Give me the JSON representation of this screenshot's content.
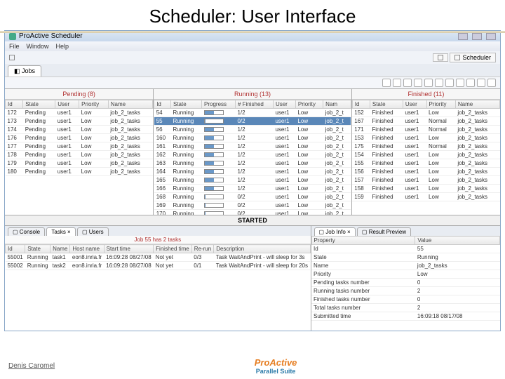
{
  "slide": {
    "title": "Scheduler: User Interface"
  },
  "window": {
    "title": "ProActive Scheduler"
  },
  "menu": {
    "items": [
      "File",
      "Window",
      "Help"
    ]
  },
  "perspective": {
    "label": "Scheduler"
  },
  "jobs_tab": {
    "label": "Jobs"
  },
  "pending": {
    "title": "Pending (8)",
    "cols": [
      "Id",
      "State",
      "User",
      "Priority",
      "Name"
    ],
    "rows": [
      [
        "172",
        "Pending",
        "user1",
        "Low",
        "job_2_tasks"
      ],
      [
        "173",
        "Pending",
        "user1",
        "Low",
        "job_2_tasks"
      ],
      [
        "174",
        "Pending",
        "user1",
        "Low",
        "job_2_tasks"
      ],
      [
        "176",
        "Pending",
        "user1",
        "Low",
        "job_2_tasks"
      ],
      [
        "177",
        "Pending",
        "user1",
        "Low",
        "job_2_tasks"
      ],
      [
        "178",
        "Pending",
        "user1",
        "Low",
        "job_2_tasks"
      ],
      [
        "179",
        "Pending",
        "user1",
        "Low",
        "job_2_tasks"
      ],
      [
        "180",
        "Pending",
        "user1",
        "Low",
        "job_2_tasks"
      ]
    ]
  },
  "running": {
    "title": "Running (13)",
    "cols": [
      "Id",
      "State",
      "Progress",
      "# Finished",
      "User",
      "Priority",
      "Nam"
    ],
    "rows": [
      {
        "d": [
          "54",
          "Running",
          "",
          "1/2",
          "user1",
          "Low",
          "job_2_t"
        ],
        "p": 50
      },
      {
        "d": [
          "55",
          "Running",
          "",
          "0/2",
          "user1",
          "Low",
          "job_2_t"
        ],
        "p": 5,
        "sel": true
      },
      {
        "d": [
          "56",
          "Running",
          "",
          "1/2",
          "user1",
          "Low",
          "job_2_t"
        ],
        "p": 50
      },
      {
        "d": [
          "160",
          "Running",
          "",
          "1/2",
          "user1",
          "Low",
          "job_2_t"
        ],
        "p": 50
      },
      {
        "d": [
          "161",
          "Running",
          "",
          "1/2",
          "user1",
          "Low",
          "job_2_t"
        ],
        "p": 50
      },
      {
        "d": [
          "162",
          "Running",
          "",
          "1/2",
          "user1",
          "Low",
          "job_2_t"
        ],
        "p": 50
      },
      {
        "d": [
          "163",
          "Running",
          "",
          "1/2",
          "user1",
          "Low",
          "job_2_t"
        ],
        "p": 50
      },
      {
        "d": [
          "164",
          "Running",
          "",
          "1/2",
          "user1",
          "Low",
          "job_2_t"
        ],
        "p": 50
      },
      {
        "d": [
          "165",
          "Running",
          "",
          "1/2",
          "user1",
          "Low",
          "job_2_t"
        ],
        "p": 50
      },
      {
        "d": [
          "166",
          "Running",
          "",
          "1/2",
          "user1",
          "Low",
          "job_2_t"
        ],
        "p": 50
      },
      {
        "d": [
          "168",
          "Running",
          "",
          "0/2",
          "user1",
          "Low",
          "job_2_t"
        ],
        "p": 5
      },
      {
        "d": [
          "169",
          "Running",
          "",
          "0/2",
          "user1",
          "Low",
          "job_2_t"
        ],
        "p": 5
      },
      {
        "d": [
          "170",
          "Running",
          "",
          "0/2",
          "user1",
          "Low",
          "job_2_t"
        ],
        "p": 5
      }
    ]
  },
  "finished": {
    "title": "Finished (11)",
    "cols": [
      "Id",
      "State",
      "User",
      "Priority",
      "Name"
    ],
    "rows": [
      [
        "152",
        "Finished",
        "user1",
        "Low",
        "job_2_tasks"
      ],
      [
        "167",
        "Finished",
        "user1",
        "Normal",
        "job_2_tasks"
      ],
      [
        "171",
        "Finished",
        "user1",
        "Normal",
        "job_2_tasks"
      ],
      [
        "153",
        "Finished",
        "user1",
        "Low",
        "job_2_tasks"
      ],
      [
        "175",
        "Finished",
        "user1",
        "Normal",
        "job_2_tasks"
      ],
      [
        "154",
        "Finished",
        "user1",
        "Low",
        "job_2_tasks"
      ],
      [
        "155",
        "Finished",
        "user1",
        "Low",
        "job_2_tasks"
      ],
      [
        "156",
        "Finished",
        "user1",
        "Low",
        "job_2_tasks"
      ],
      [
        "157",
        "Finished",
        "user1",
        "Low",
        "job_2_tasks"
      ],
      [
        "158",
        "Finished",
        "user1",
        "Low",
        "job_2_tasks"
      ],
      [
        "159",
        "Finished",
        "user1",
        "Low",
        "job_2_tasks"
      ]
    ]
  },
  "status": {
    "text": "STARTED"
  },
  "console": {
    "tabs": [
      "Console",
      "Tasks",
      "Users"
    ],
    "header": "Job 55 has 2 tasks",
    "cols": [
      "Id",
      "State",
      "Name",
      "Host name",
      "Start time",
      "Finished time",
      "Re-run",
      "Description"
    ],
    "rows": [
      [
        "55001",
        "Running",
        "task1",
        "eon8.inria.fr",
        "16:09:28 08/27/08",
        "Not yet",
        "0/3",
        "Task WaitAndPrint - will sleep for 3s"
      ],
      [
        "55002",
        "Running",
        "task2",
        "eon8.inria.fr",
        "16:09:28 08/27/08",
        "Not yet",
        "0/1",
        "Task WaitAndPrint - will sleep for 20s"
      ]
    ]
  },
  "jobinfo": {
    "tabs": [
      "Job Info",
      "Result Preview"
    ],
    "cols": [
      "Property",
      "Value"
    ],
    "rows": [
      [
        "Id",
        "55"
      ],
      [
        "State",
        "Running"
      ],
      [
        "Name",
        "job_2_tasks"
      ],
      [
        "Priority",
        "Low"
      ],
      [
        "Pending tasks number",
        "0"
      ],
      [
        "Running tasks number",
        "2"
      ],
      [
        "Finished tasks number",
        "0"
      ],
      [
        "Total tasks number",
        "2"
      ],
      [
        "Submitted time",
        "16:09:18 08/17/08"
      ]
    ]
  },
  "footer": {
    "author": "Denis Caromel",
    "logo": "ProActive",
    "logosub": "Parallel Suite"
  }
}
